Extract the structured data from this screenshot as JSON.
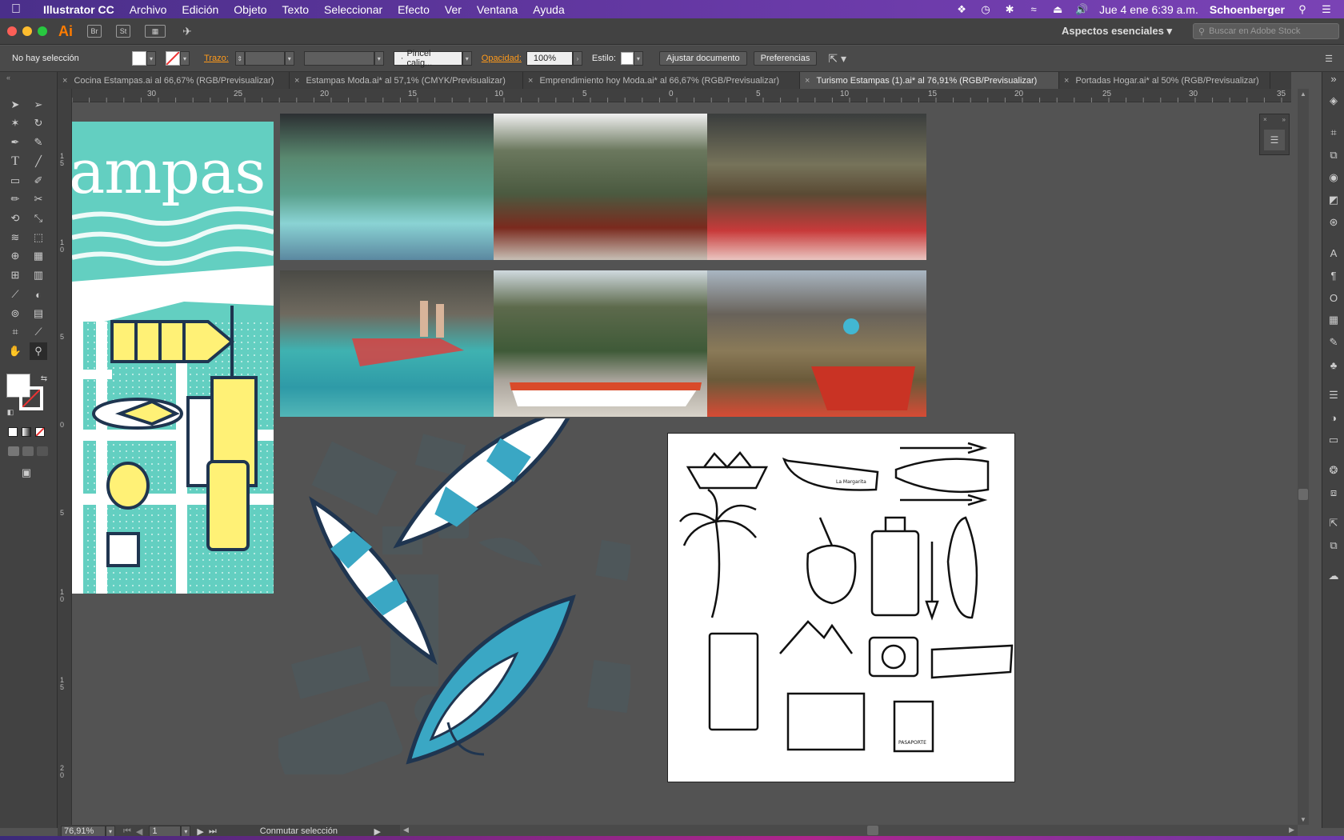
{
  "menubar": {
    "app": "Illustrator CC",
    "items": [
      "Archivo",
      "Edición",
      "Objeto",
      "Texto",
      "Seleccionar",
      "Efecto",
      "Ver",
      "Ventana",
      "Ayuda"
    ],
    "datetime": "Jue 4 ene  6:39 a.m.",
    "user": "Schoenberger"
  },
  "appbar": {
    "logo": "Ai",
    "br": "Br",
    "st": "St",
    "workspace": "Aspectos esenciales",
    "stock_placeholder": "Buscar en Adobe Stock"
  },
  "control": {
    "selection": "No hay selección",
    "stroke_label": "Trazo:",
    "brush": "Pincel calig...",
    "opacity_label": "Opacidad:",
    "opacity_value": "100%",
    "style_label": "Estilo:",
    "adjust_doc": "Ajustar documento",
    "prefs": "Preferencias"
  },
  "tabs": [
    {
      "label": "Cocina Estampas.ai al 66,67% (RGB/Previsualizar)",
      "active": false
    },
    {
      "label": "Estampas Moda.ai* al 57,1% (CMYK/Previsualizar)",
      "active": false
    },
    {
      "label": "Emprendimiento hoy Moda.ai* al 66,67% (RGB/Previsualizar)",
      "active": false
    },
    {
      "label": "Turismo Estampas (1).ai* al 76,91% (RGB/Previsualizar)",
      "active": true
    },
    {
      "label": "Portadas Hogar.ai* al 50% (RGB/Previsualizar)",
      "active": false
    }
  ],
  "ruler_top": [
    "30",
    "25",
    "20",
    "15",
    "10",
    "5",
    "0",
    "5",
    "10",
    "15",
    "20",
    "25",
    "30",
    "35"
  ],
  "ruler_left": [
    "1\n5",
    "1\n0",
    "5",
    "0",
    "5",
    "1\n0",
    "1\n5",
    "2\n0"
  ],
  "canvas": {
    "board_title": "ampas",
    "sticker_boat_name": "La Margarita",
    "passport": "PASAPORTE"
  },
  "status": {
    "zoom": "76,91%",
    "page": "1",
    "mode": "Conmutar selección"
  },
  "colors": {
    "teal": "#63cfc1",
    "blue": "#3aa7c4",
    "navy": "#1f3550",
    "yellow": "#fff176",
    "illustrator_orange": "#ff7c00"
  }
}
